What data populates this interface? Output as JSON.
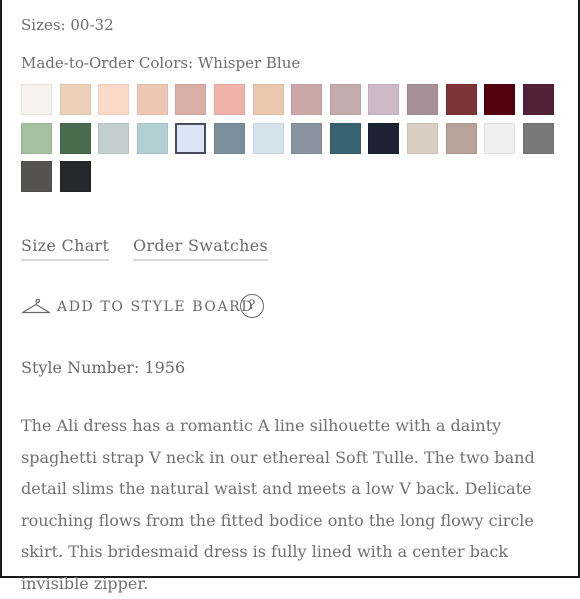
{
  "sizes_text": "Sizes: 00-32",
  "colors_label": "Made-to-Order Colors: Whisper Blue",
  "swatches": [
    {
      "name": "white",
      "color": "#f6f3ef"
    },
    {
      "name": "peach",
      "color": "#ecd0b8"
    },
    {
      "name": "blush",
      "color": "#fad9c9"
    },
    {
      "name": "apricot",
      "color": "#eec7b2"
    },
    {
      "name": "dusty-rose",
      "color": "#d9aea4"
    },
    {
      "name": "coral",
      "color": "#f0b3a9"
    },
    {
      "name": "sand",
      "color": "#ebc7ae"
    },
    {
      "name": "mauve-blush",
      "color": "#cba7a7"
    },
    {
      "name": "taupe-rose",
      "color": "#c4acad"
    },
    {
      "name": "lilac",
      "color": "#ccb8c9"
    },
    {
      "name": "mauve",
      "color": "#a89099"
    },
    {
      "name": "brick",
      "color": "#7e3336"
    },
    {
      "name": "wine",
      "color": "#53020e"
    },
    {
      "name": "plum",
      "color": "#542035"
    },
    {
      "name": "sage",
      "color": "#a5c0a1"
    },
    {
      "name": "forest",
      "color": "#4a6b4e"
    },
    {
      "name": "mist",
      "color": "#c4cfcd"
    },
    {
      "name": "aqua",
      "color": "#b2d0d4"
    },
    {
      "name": "whisper-blue",
      "color": "#dae4f4"
    },
    {
      "name": "slate-blue",
      "color": "#7a8f9c"
    },
    {
      "name": "ice",
      "color": "#d5e4ea"
    },
    {
      "name": "dusk",
      "color": "#8b93a1"
    },
    {
      "name": "teal",
      "color": "#386270"
    },
    {
      "name": "navy",
      "color": "#1c2133"
    },
    {
      "name": "ivory-taupe",
      "color": "#d8cfc2"
    },
    {
      "name": "cocoa",
      "color": "#b8a299"
    },
    {
      "name": "silver",
      "color": "#efefef"
    },
    {
      "name": "graphite",
      "color": "#787878"
    },
    {
      "name": "charcoal",
      "color": "#555351"
    },
    {
      "name": "black",
      "color": "#25282a"
    }
  ],
  "selected_swatch": "whisper-blue",
  "links": {
    "size_chart": "Size Chart",
    "order_swatches": "Order Swatches"
  },
  "style_board": {
    "label": "ADD TO STYLE BOARD",
    "help": "?"
  },
  "style_number": "Style Number: 1956",
  "description": "The Ali dress has a romantic A line silhouette with a dainty spaghetti strap V neck in our ethereal Soft Tulle. The two band detail slims the natural waist and meets a low V back. Delicate rouching flows from the fitted bodice onto the long flowy circle skirt. This bridesmaid dress is fully lined with a center back invisible zipper."
}
